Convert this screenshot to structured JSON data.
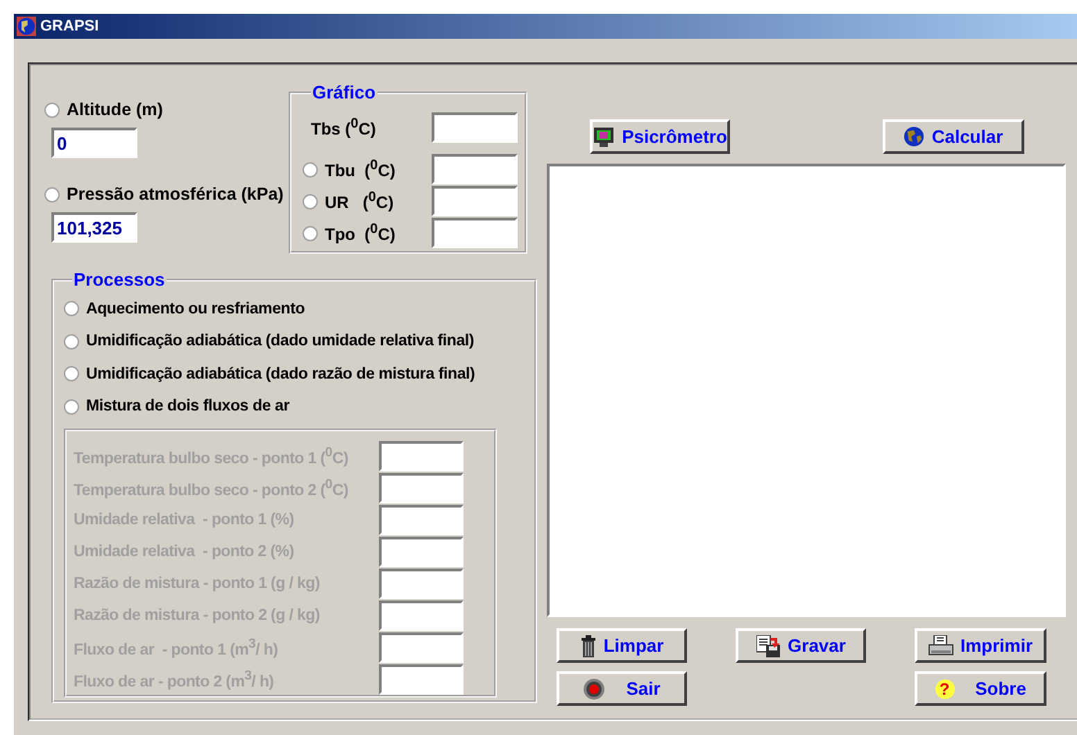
{
  "window": {
    "title": "GRAPSI"
  },
  "location": {
    "options": [
      {
        "label": "Altitude (m)",
        "selected": false,
        "value": "0"
      },
      {
        "label": "Pressão atmosférica (kPa)",
        "selected": false,
        "value": "101,325"
      }
    ]
  },
  "grafico": {
    "title": "Gráfico",
    "rows": [
      {
        "kind": "plain",
        "label": "Tbs ($^{0}$C)",
        "value": ""
      },
      {
        "kind": "radio",
        "label": "Tbu  ($^{0}$C)",
        "selected": false
      },
      {
        "kind": "radio",
        "label": "UR   ($^{0}$C)",
        "selected": false
      },
      {
        "kind": "radio",
        "label": "Tpo  ($^{0}$C)",
        "selected": false
      }
    ]
  },
  "processos": {
    "title": "Processos",
    "options": [
      {
        "label": "Aquecimento ou resfriamento",
        "selected": false
      },
      {
        "label": "Umidificação adiabática (dado umidade relativa final)",
        "selected": false
      },
      {
        "label": "Umidificação adiabática (dado razão de mistura final)",
        "selected": false
      },
      {
        "label": "Mistura de dois fluxos de ar",
        "selected": false
      }
    ],
    "parameters": {
      "disabled": true,
      "fields": [
        "Temperatura bulbo seco - ponto 1 ($^{0}$C)",
        "Temperatura bulbo seco - ponto 2 ($^{0}$C)",
        "Umidade relativa  - ponto 1 (%)",
        "Umidade relativa  - ponto 2 (%)",
        "Razão de mistura - ponto 1 (g / kg)",
        "Razão de mistura - ponto 2 (g / kg)",
        "Fluxo de ar  - ponto 1 (m$^{3}$/ h)",
        "Fluxo de ar - ponto 2 (m$^{3}$/ h)"
      ]
    }
  },
  "buttons": {
    "psicrometro": "Psicrômetro",
    "calcular": "Calcular",
    "limpar": "Limpar",
    "gravar": "Gravar",
    "imprimir": "Imprimir",
    "sair": "Sair",
    "sobre": "Sobre",
    "sobre_icon": "?"
  }
}
